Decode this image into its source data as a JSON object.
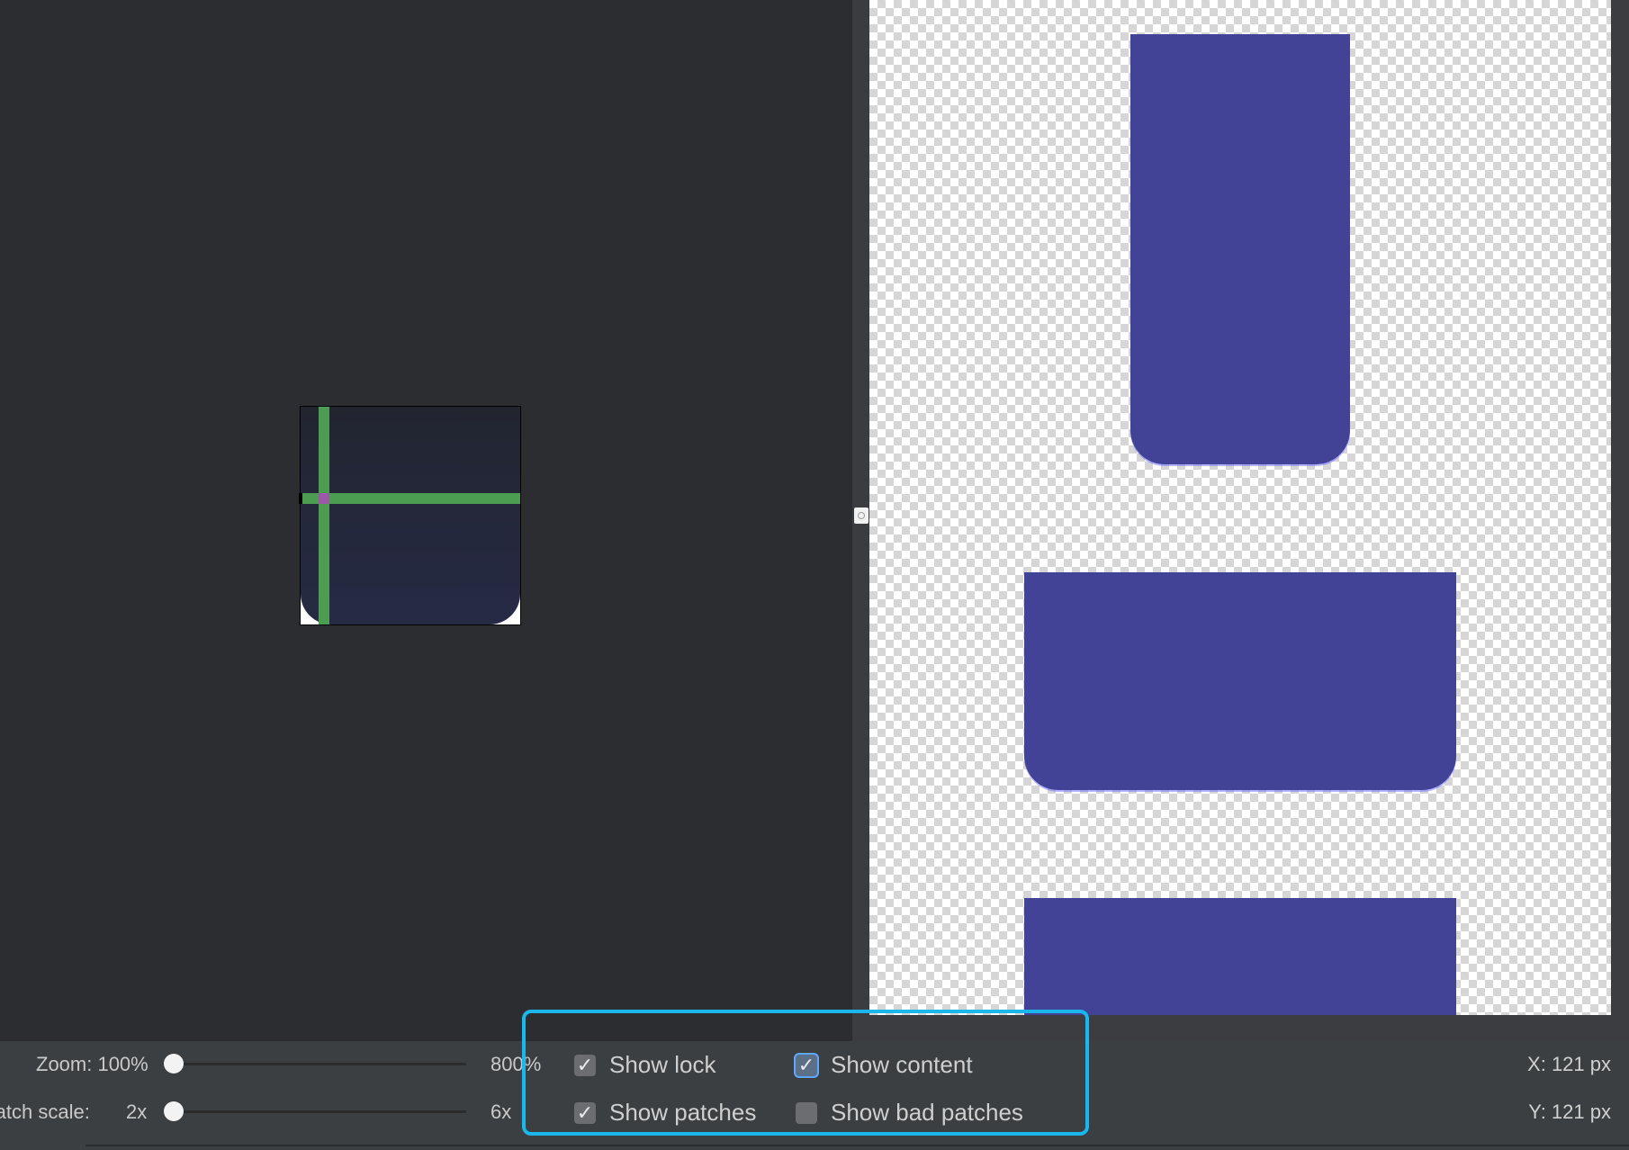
{
  "editor": {
    "guide_color": "#4c9c52",
    "intersection_color": "#9b59a7"
  },
  "preview": {
    "block_color": "#424297"
  },
  "controls": {
    "zoom_label": "Zoom: 100%",
    "zoom_max": "800%",
    "zoom_value_percent": 100,
    "patch_scale_label": "Patch scale:",
    "patch_scale_min": "2x",
    "patch_scale_max": "6x",
    "patch_scale_value": 2
  },
  "options": {
    "show_lock": {
      "label": "Show lock",
      "checked": true
    },
    "show_content": {
      "label": "Show content",
      "checked": true
    },
    "show_patches": {
      "label": "Show patches",
      "checked": true
    },
    "show_bad_patches": {
      "label": "Show bad patches",
      "checked": false
    }
  },
  "status": {
    "x": "X: 121 px",
    "y": "Y: 121 px"
  },
  "highlight_color": "#19b7ec"
}
